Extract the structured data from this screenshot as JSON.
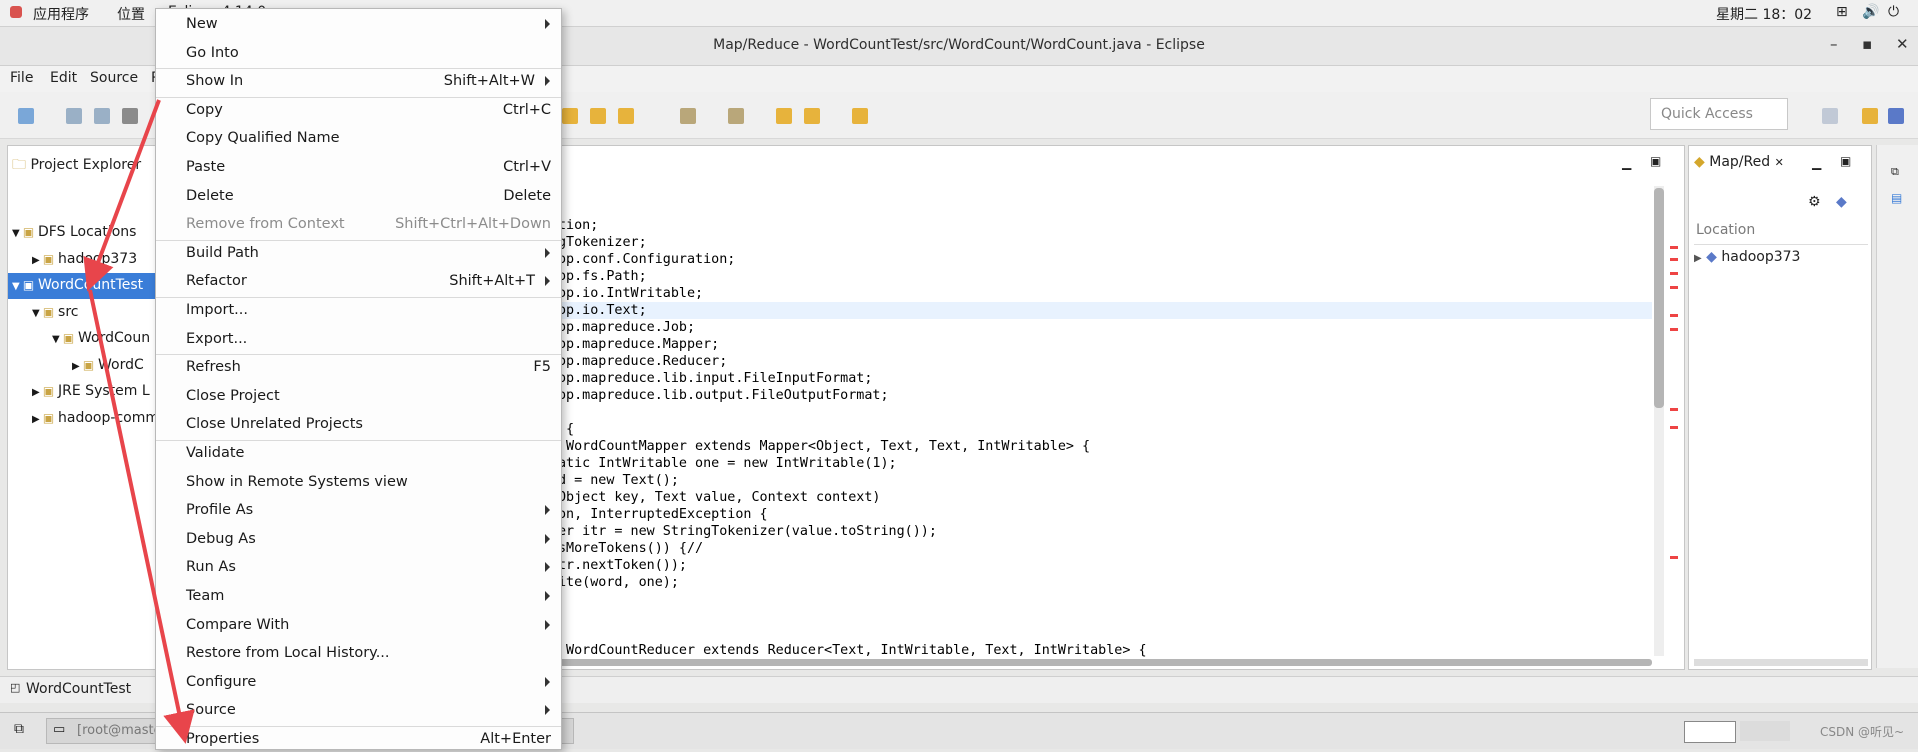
{
  "gnome_bar": {
    "apps": "应用程序",
    "places": "位置",
    "window_menu": "Eclipse 4.14.0",
    "clock": "星期二 18：02"
  },
  "window": {
    "title": "Map/Reduce - WordCountTest/src/WordCount/WordCount.java - Eclipse",
    "menus": [
      "File",
      "Edit",
      "Source",
      "R"
    ]
  },
  "toolbar": {
    "quick_access_placeholder": "Quick Access"
  },
  "project_explorer": {
    "tab_label": "Project Explorer",
    "tree": [
      {
        "label": "DFS Locations",
        "indent": 0,
        "expanded": true
      },
      {
        "label": "hadoop373",
        "indent": 1,
        "expanded": false
      },
      {
        "label": "WordCountTest",
        "indent": 0,
        "expanded": true,
        "selected": true
      },
      {
        "label": "src",
        "indent": 1,
        "expanded": true
      },
      {
        "label": "WordCoun",
        "indent": 2,
        "expanded": true
      },
      {
        "label": "WordC",
        "indent": 3,
        "expanded": false
      },
      {
        "label": "JRE System L",
        "indent": 1,
        "expanded": false
      },
      {
        "label": "hadoop-comm",
        "indent": 1,
        "expanded": false
      }
    ]
  },
  "editor": {
    "code_lines": [
      "tion;",
      "gTokenizer;",
      "op.conf.Configuration;",
      "op.fs.Path;",
      "op.io.IntWritable;",
      "op.io.Text;",
      "op.mapreduce.Job;",
      "op.mapreduce.Mapper;",
      "op.mapreduce.Reducer;",
      "op.mapreduce.lib.input.FileInputFormat;",
      "op.mapreduce.lib.output.FileOutputFormat;",
      "",
      " {",
      " WordCountMapper extends Mapper<Object, Text, Text, IntWritable> {",
      "atic IntWritable one = new IntWritable(1);",
      "d = new Text();",
      "Object key, Text value, Context context)",
      "on, InterruptedException {",
      "er itr = new StringTokenizer(value.toString());",
      "sMoreTokens()) {//",
      "tr.nextToken());",
      "ite(word, one);",
      "",
      "",
      "",
      " WordCountReducer extends Reducer<Text, IntWritable, Text, IntWritable> {"
    ]
  },
  "mapred_panel": {
    "tab_label": "Map/Red",
    "location_header": "Location",
    "items": [
      "hadoop373"
    ]
  },
  "status": {
    "selected": "WordCountTest",
    "taskbar_item": "[root@maste",
    "watermark": "CSDN @听见~"
  },
  "context_menu": {
    "items": [
      {
        "label": "New",
        "accel": "",
        "submenu": true,
        "disabled": false,
        "sep_after": false
      },
      {
        "label": "Go Into",
        "accel": "",
        "submenu": false,
        "disabled": false,
        "sep_after": true
      },
      {
        "label": "Show In",
        "accel": "Shift+Alt+W",
        "submenu": true,
        "disabled": false,
        "sep_after": true
      },
      {
        "label": "Copy",
        "accel": "Ctrl+C",
        "submenu": false,
        "disabled": false,
        "sep_after": false
      },
      {
        "label": "Copy Qualified Name",
        "accel": "",
        "submenu": false,
        "disabled": false,
        "sep_after": false
      },
      {
        "label": "Paste",
        "accel": "Ctrl+V",
        "submenu": false,
        "disabled": false,
        "sep_after": false
      },
      {
        "label": "Delete",
        "accel": "Delete",
        "submenu": false,
        "disabled": false,
        "sep_after": false
      },
      {
        "label": "Remove from Context",
        "accel": "Shift+Ctrl+Alt+Down",
        "submenu": false,
        "disabled": true,
        "sep_after": true
      },
      {
        "label": "Build Path",
        "accel": "",
        "submenu": true,
        "disabled": false,
        "sep_after": false
      },
      {
        "label": "Refactor",
        "accel": "Shift+Alt+T",
        "submenu": true,
        "disabled": false,
        "sep_after": true
      },
      {
        "label": "Import...",
        "accel": "",
        "submenu": false,
        "disabled": false,
        "sep_after": false
      },
      {
        "label": "Export...",
        "accel": "",
        "submenu": false,
        "disabled": false,
        "sep_after": true
      },
      {
        "label": "Refresh",
        "accel": "F5",
        "submenu": false,
        "disabled": false,
        "sep_after": false
      },
      {
        "label": "Close Project",
        "accel": "",
        "submenu": false,
        "disabled": false,
        "sep_after": false
      },
      {
        "label": "Close Unrelated Projects",
        "accel": "",
        "submenu": false,
        "disabled": false,
        "sep_after": true
      },
      {
        "label": "Validate",
        "accel": "",
        "submenu": false,
        "disabled": false,
        "sep_after": false
      },
      {
        "label": "Show in Remote Systems view",
        "accel": "",
        "submenu": false,
        "disabled": false,
        "sep_after": false
      },
      {
        "label": "Profile As",
        "accel": "",
        "submenu": true,
        "disabled": false,
        "sep_after": false
      },
      {
        "label": "Debug As",
        "accel": "",
        "submenu": true,
        "disabled": false,
        "sep_after": false
      },
      {
        "label": "Run As",
        "accel": "",
        "submenu": true,
        "disabled": false,
        "sep_after": false
      },
      {
        "label": "Team",
        "accel": "",
        "submenu": true,
        "disabled": false,
        "sep_after": false
      },
      {
        "label": "Compare With",
        "accel": "",
        "submenu": true,
        "disabled": false,
        "sep_after": false
      },
      {
        "label": "Restore from Local History...",
        "accel": "",
        "submenu": false,
        "disabled": false,
        "sep_after": false
      },
      {
        "label": "Configure",
        "accel": "",
        "submenu": true,
        "disabled": false,
        "sep_after": false
      },
      {
        "label": "Source",
        "accel": "",
        "submenu": true,
        "disabled": false,
        "sep_after": true
      },
      {
        "label": "Properties",
        "accel": "Alt+Enter",
        "submenu": false,
        "disabled": false,
        "sep_after": false
      }
    ]
  },
  "colors": {
    "selection": "#3a7dd8",
    "annotation_arrow": "#e8454b",
    "keyword": "#7f0055"
  }
}
